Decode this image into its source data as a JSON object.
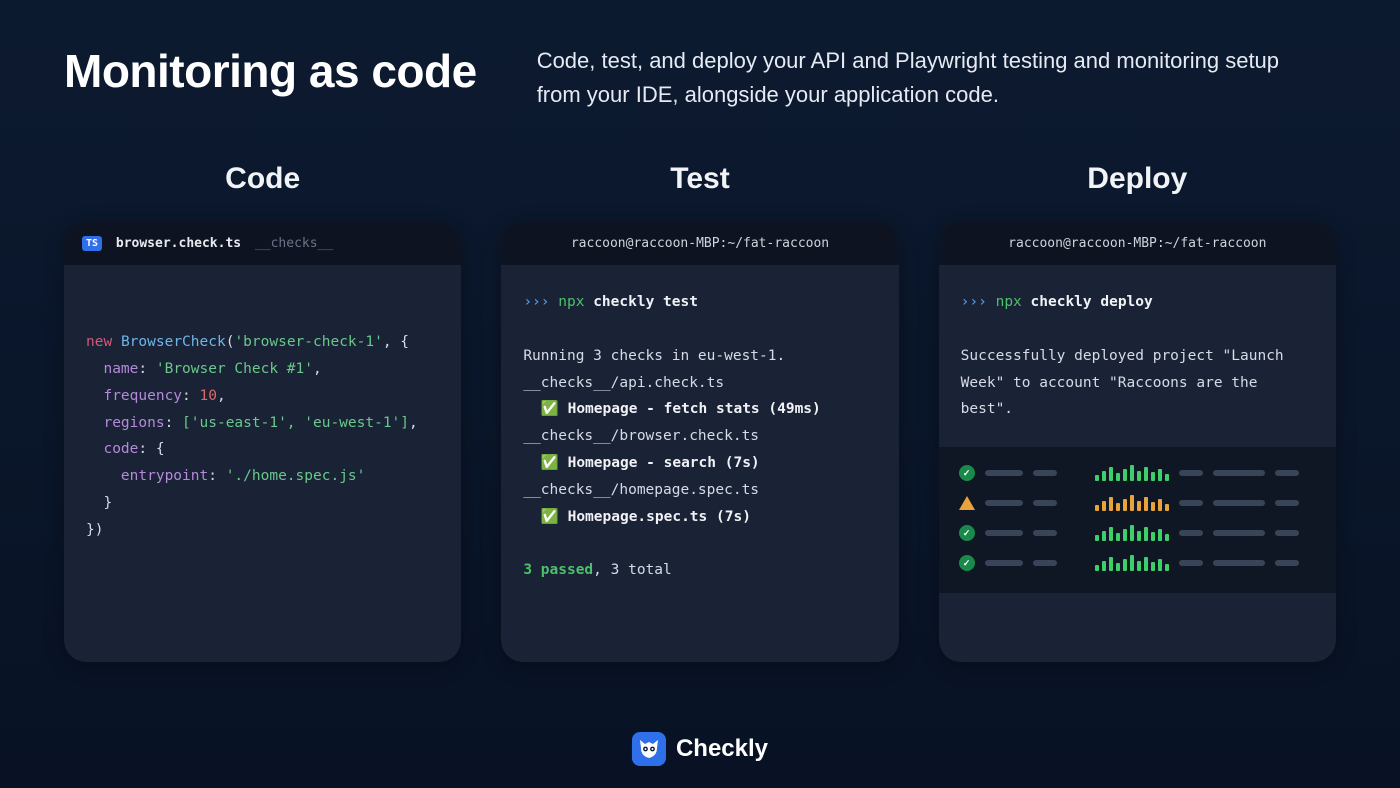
{
  "hero": {
    "title": "Monitoring as code",
    "subtitle": "Code, test, and deploy your API and Playwright testing and monitoring setup from your IDE, alongside your application code."
  },
  "columns": {
    "code": {
      "title": "Code",
      "badge": "TS",
      "filename": "browser.check.ts",
      "folder": "__checks__",
      "snippet": {
        "keyword_new": "new",
        "class": "BrowserCheck",
        "arg_id": "'browser-check-1'",
        "prop_name": "name",
        "val_name": "'Browser Check #1'",
        "prop_freq": "frequency",
        "val_freq": "10",
        "prop_regions": "regions",
        "val_regions": "['us-east-1', 'eu-west-1']",
        "prop_code": "code",
        "prop_entry": "entrypoint",
        "val_entry": "'./home.spec.js'"
      }
    },
    "test": {
      "title": "Test",
      "terminal_title": "raccoon@raccoon-MBP:~/fat-raccoon",
      "prompt": "›››",
      "npx": "npx",
      "command": "checkly test",
      "line_running": "Running 3 checks in eu-west-1.",
      "line_file1": "__checks__/api.check.ts",
      "line_check1": "Homepage - fetch stats (49ms)",
      "line_file2": "__checks__/browser.check.ts",
      "line_check2": "Homepage - search (7s)",
      "line_file3": "__checks__/homepage.spec.ts",
      "line_check3": "Homepage.spec.ts (7s)",
      "summary_passed": "3 passed",
      "summary_rest": ", 3 total",
      "check_emoji": "✅"
    },
    "deploy": {
      "title": "Deploy",
      "terminal_title": "raccoon@raccoon-MBP:~/fat-raccoon",
      "prompt": "›››",
      "npx": "npx",
      "command": "checkly deploy",
      "result": "Successfully deployed project \"Launch Week\" to account \"Raccoons are the best\".",
      "art_rows": [
        {
          "status": "ok",
          "color": "green"
        },
        {
          "status": "warn",
          "color": "orange"
        },
        {
          "status": "ok",
          "color": "green"
        },
        {
          "status": "ok",
          "color": "green"
        }
      ]
    }
  },
  "brand": {
    "name": "Checkly"
  }
}
